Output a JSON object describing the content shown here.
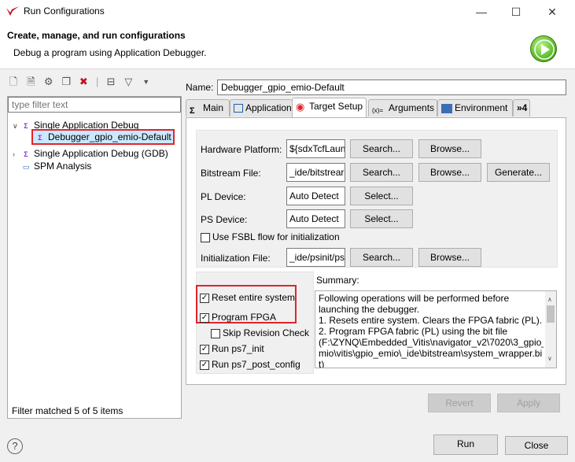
{
  "window": {
    "title": "Run Configurations",
    "minimize": "—",
    "maximize": "☐",
    "close": "✕"
  },
  "header": {
    "title": "Create, manage, and run configurations",
    "subtitle": "Debug a program using Application Debugger."
  },
  "left": {
    "filter_placeholder": "type filter text",
    "tree": [
      {
        "label": "Single Application Debug",
        "expanded": true
      },
      {
        "label": "Debugger_gpio_emio-Default",
        "selected": true
      },
      {
        "label": "Single Application Debug (GDB)",
        "expanded": false
      },
      {
        "label": "SPM Analysis"
      }
    ],
    "status": "Filter matched 5 of 5 items"
  },
  "right": {
    "name_label": "Name:",
    "name_value": "Debugger_gpio_emio-Default",
    "tabs": [
      {
        "label": "Main"
      },
      {
        "label": "Application"
      },
      {
        "label": "Target Setup",
        "active": true
      },
      {
        "label": "Arguments"
      },
      {
        "label": "Environment"
      },
      {
        "label": "»4"
      }
    ],
    "form": {
      "hw_platform_label": "Hardware Platform:",
      "hw_platform_value": "${sdxTcfLaun",
      "bitstream_label": "Bitstream File:",
      "bitstream_value": "_ide/bitstrear",
      "pl_device_label": "PL Device:",
      "pl_device_value": "Auto Detect",
      "ps_device_label": "PS Device:",
      "ps_device_value": "Auto Detect",
      "fsbl_label": "Use FSBL flow for initialization",
      "init_file_label": "Initialization File:",
      "init_file_value": "_ide/psinit/ps",
      "search": "Search...",
      "browse": "Browse...",
      "generate": "Generate...",
      "select": "Select..."
    },
    "checks": {
      "reset": "Reset entire system",
      "program_fpga": "Program FPGA",
      "skip_revision": "Skip Revision Check",
      "ps7_init": "Run ps7_init",
      "ps7_post": "Run ps7_post_config"
    },
    "summary_label": "Summary:",
    "summary_lines": [
      "Following operations will be performed before",
      "launching the debugger.",
      "1. Resets entire system. Clears the FPGA fabric (PL).",
      "2. Program FPGA fabric (PL) using the bit file",
      "(F:\\ZYNQ\\Embedded_Vitis\\navigator_v2\\7020\\3_gpio_e",
      "mio\\vitis\\gpio_emio\\_ide\\bitstream\\system_wrapper.bi",
      "t)"
    ],
    "revert": "Revert",
    "apply": "Apply"
  },
  "bottom": {
    "help": "?",
    "run": "Run",
    "close": "Close"
  },
  "colors": {
    "highlight": "#e0252b",
    "selection": "#cce8ff",
    "run_logo": "#4fb31c"
  }
}
